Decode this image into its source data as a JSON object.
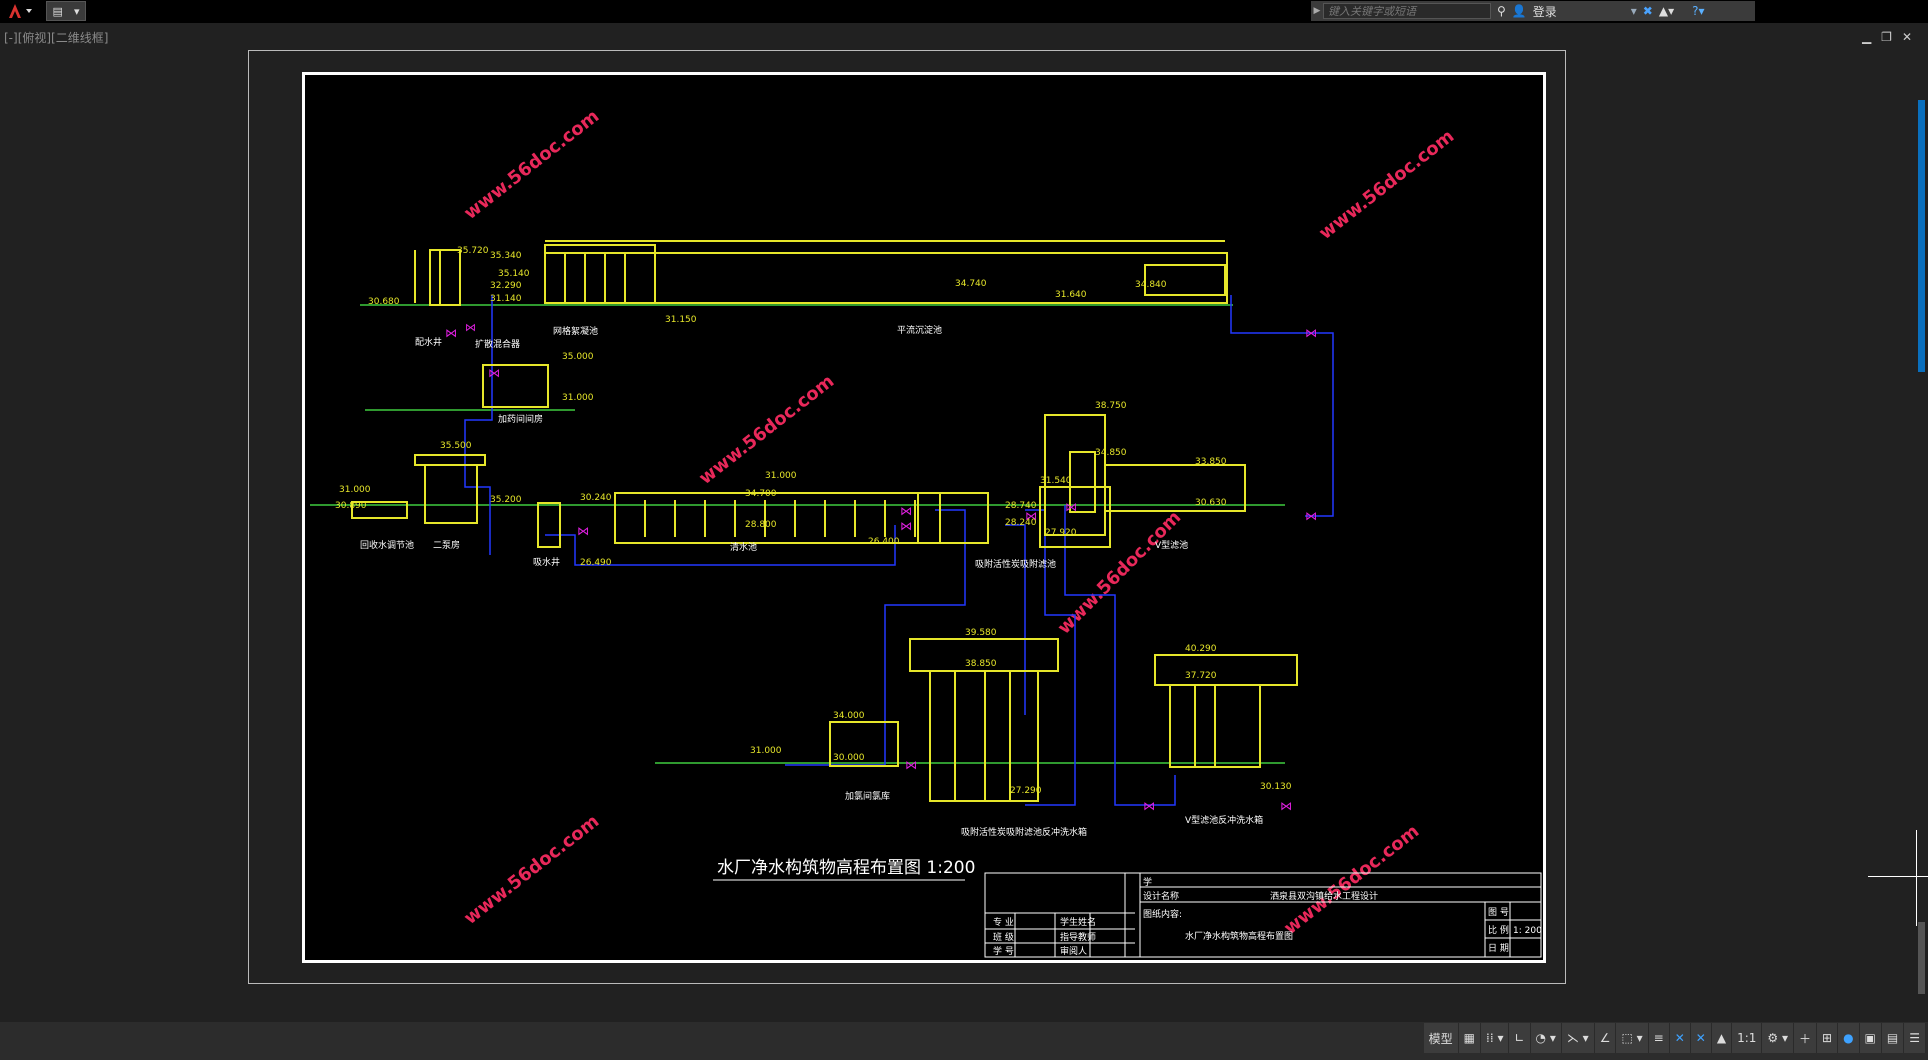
{
  "search": {
    "placeholder": "键入关键字或短语",
    "login": "登录"
  },
  "viewport_label": "[-][俯视][二维线框]",
  "drawing": {
    "title": "水厂净水构筑物高程布置图 1:200",
    "watermark": "www.56doc.com",
    "labels": {
      "intake_well": "配水井",
      "mixer": "扩散混合器",
      "flocculation": "网格絮凝池",
      "sedimentation": "平流沉淀池",
      "dosing_room": "加药间间房",
      "pump_well": "回收水调节池",
      "second_pump": "二泵房",
      "suction_well": "吸水井",
      "clear_tank": "清水池",
      "filter_wash": "吸附活性炭吸附滤池",
      "v_filter": "V型滤池",
      "chlorine_room": "加氯间氯库",
      "wash_tank1": "吸附活性炭吸附滤池反冲洗水箱",
      "wash_tank2": "V型滤池反冲洗水箱"
    },
    "elevations": {
      "e1": "35.720",
      "e2": "35.340",
      "e3": "30.680",
      "e4": "35.140",
      "e5": "32.290",
      "e6": "31.140",
      "e7": "34.740",
      "e8": "31.640",
      "e9": "34.840",
      "e10": "31.150",
      "e11": "35.000",
      "e12": "31.000",
      "e13": "35.500",
      "e14": "31.000",
      "e15": "30.890",
      "e16": "35.200",
      "e17": "30.240",
      "e18": "31.000",
      "e19": "34.700",
      "e20": "28.800",
      "e21": "26.400",
      "e22": "26.490",
      "e23": "31.540",
      "e24": "28.740",
      "e25": "28.240",
      "e26": "27.920",
      "e27": "38.750",
      "e28": "34.850",
      "e29": "33.850",
      "e30": "30.630",
      "e31": "39.580",
      "e32": "38.850",
      "e33": "40.290",
      "e34": "37.720",
      "e35": "34.000",
      "e36": "30.000",
      "e37": "31.000",
      "e38": "27.290",
      "e39": "30.130"
    },
    "title_block": {
      "design_name_label": "设计名称",
      "design_name": "洒泉县双沟镇给水工程设计",
      "content_label": "图纸内容:",
      "content": "水厂净水构筑物高程布置图",
      "r1": [
        "专 业",
        "学生姓名"
      ],
      "r2": [
        "班 级",
        "指导教师"
      ],
      "r3": [
        "学 号",
        "审阅人"
      ],
      "right_labels": [
        "图 号",
        "比 例",
        "日 期"
      ],
      "scale": "1: 200",
      "top_label": "学"
    }
  },
  "statusbar": {
    "model": "模型",
    "scale": "1:1"
  }
}
